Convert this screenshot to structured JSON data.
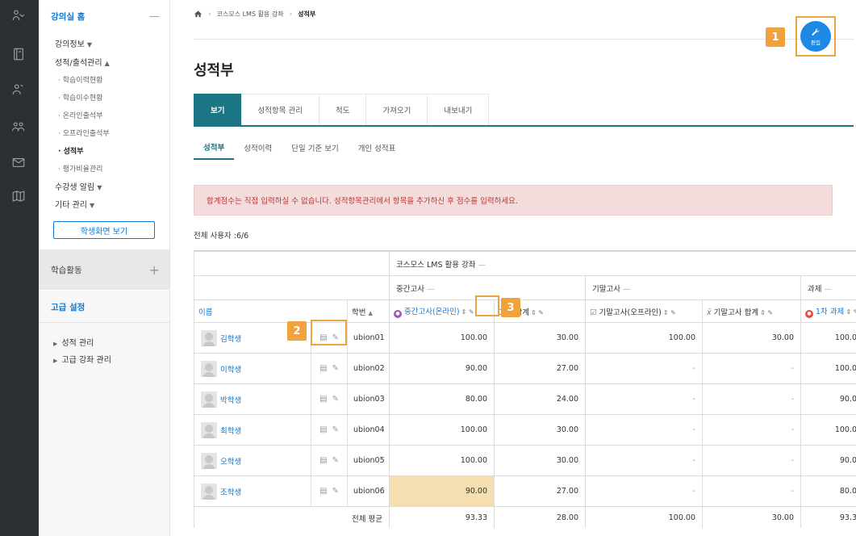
{
  "rail": {
    "icons": [
      "users-icon",
      "book-icon",
      "people-icon",
      "group-icon",
      "mail-icon",
      "map-icon"
    ]
  },
  "sidebar": {
    "course_home": "강의실 홈",
    "course_home_ctrl": "—",
    "course_info": "강의정보",
    "grades_attendance": "성적/출석관리",
    "sub_items": [
      "학습이력현황",
      "학습이수현황",
      "온라인출석부",
      "오프라인출석부",
      "성적부",
      "평가비율관리"
    ],
    "active_sub": "성적부",
    "student_notice": "수강생 알림",
    "other_mgmt": "기타 관리",
    "student_view_button": "학생화면 보기",
    "activities": "학습활동",
    "activities_ctrl": "+",
    "advanced": "고급 설정",
    "tree": [
      "성적 관리",
      "고급 강좌 관리"
    ]
  },
  "breadcrumb": {
    "course": "코스모스 LMS 활용 강좌",
    "current": "성적부"
  },
  "edit_button": {
    "label": "편집"
  },
  "callouts": [
    "1",
    "2",
    "3"
  ],
  "page_title": "성적부",
  "tabs": [
    "보기",
    "성적항목 관리",
    "척도",
    "가져오기",
    "내보내기"
  ],
  "subtabs": [
    "성적부",
    "성적이력",
    "단일 기준 보기",
    "개인 성적표"
  ],
  "alert": "합계점수는 직접 입력하실 수 없습니다. 성적항목관리에서 항목을 추가하신 후 점수를 입력하세요.",
  "total_users": "전체 사용자 :6/6",
  "grade_table": {
    "course_category": "코스모스 LMS 활용 강좌",
    "categories": [
      "중간고사",
      "기말고사",
      "과제"
    ],
    "category_dash": "—",
    "name_header": "이름",
    "id_header": "학번",
    "id_sort": "▲",
    "item_headers": [
      "중간고사(온라인)",
      "고사 합계",
      "기말고사(오프라인)",
      "기말고사 합계",
      "1차 과제"
    ],
    "rows": [
      {
        "name": "김학생",
        "id": "ubion01",
        "values": [
          "100.00",
          "30.00",
          "100.00",
          "30.00",
          "100.0"
        ]
      },
      {
        "name": "이학생",
        "id": "ubion02",
        "values": [
          "90.00",
          "27.00",
          "-",
          "-",
          "100.0"
        ]
      },
      {
        "name": "박학생",
        "id": "ubion03",
        "values": [
          "80.00",
          "24.00",
          "-",
          "-",
          "90.0"
        ]
      },
      {
        "name": "최학생",
        "id": "ubion04",
        "values": [
          "100.00",
          "30.00",
          "-",
          "-",
          "100.0"
        ]
      },
      {
        "name": "오학생",
        "id": "ubion05",
        "values": [
          "100.00",
          "30.00",
          "-",
          "-",
          "90.0"
        ]
      },
      {
        "name": "조학생",
        "id": "ubion06",
        "values": [
          "90.00",
          "27.00",
          "-",
          "-",
          "80.0"
        ]
      }
    ],
    "average_label": "전체 평균",
    "averages": [
      "93.33",
      "28.00",
      "100.00",
      "30.00",
      "93.3"
    ]
  }
}
